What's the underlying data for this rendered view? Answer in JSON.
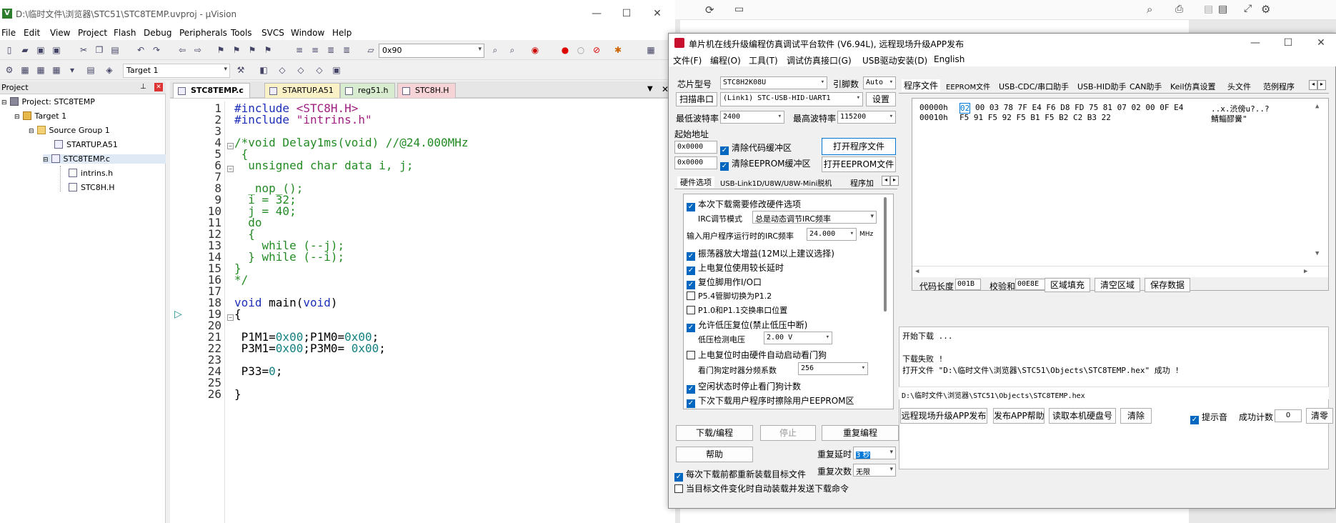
{
  "uvision": {
    "title": "D:\\临时文件\\浏览器\\STC51\\STC8TEMP.uvproj - µVision",
    "menu": [
      "File",
      "Edit",
      "View",
      "Project",
      "Flash",
      "Debug",
      "Peripherals",
      "Tools",
      "SVCS",
      "Window",
      "Help"
    ],
    "toolbar_value": "0x90",
    "target_select": "Target 1",
    "project_header": "Project",
    "tree": {
      "project": "Project: STC8TEMP",
      "target": "Target 1",
      "group": "Source Group 1",
      "files": [
        "STARTUP.A51",
        "STC8TEMP.c",
        "intrins.h",
        "STC8H.H"
      ]
    },
    "tabs": [
      "STC8TEMP.c",
      "STARTUP.A51",
      "reg51.h",
      "STC8H.H"
    ],
    "line_numbers": [
      "1",
      "2",
      "3",
      "4",
      "5",
      "6",
      "7",
      "8",
      "9",
      "10",
      "11",
      "12",
      "13",
      "14",
      "15",
      "16",
      "17",
      "18",
      "19",
      "20",
      "21",
      "22",
      "23",
      "24",
      "25",
      "26"
    ]
  },
  "isp": {
    "title": "单片机在线升级编程仿真调试平台软件 (V6.94L), 远程现场升级APP发布",
    "menu": [
      "文件(F)",
      "编程(O)",
      "工具(T)",
      "调试仿真接口(G)",
      "USB驱动安装(D)",
      "English"
    ],
    "chip_label": "芯片型号",
    "chip_value": "STC8H2K08U",
    "pin_label": "引脚数",
    "pin_value": "Auto",
    "port_btn": "扫描串口",
    "port_value": "(Link1) STC-USB-HID-UART1",
    "settings_btn": "设置",
    "min_baud_label": "最低波特率",
    "min_baud_value": "2400",
    "max_baud_label": "最高波特率",
    "max_baud_value": "115200",
    "start_addr_label": "起始地址",
    "addr1": "0x0000",
    "addr2": "0x0000",
    "clear_code": "清除代码缓冲区",
    "clear_eeprom": "清除EEPROM缓冲区",
    "open_prog_btn": "打开程序文件",
    "open_eeprom_btn": "打开EEPROM文件",
    "opt_tabs": [
      "硬件选项",
      "USB-Link1D/U8W/U8W-Mini脱机",
      "程序加"
    ],
    "opts": {
      "o1": "本次下载需要修改硬件选项",
      "irc_mode_label": "IRC调节模式",
      "irc_mode_value": "总是动态调节IRC频率",
      "irc_freq_label": "输入用户程序运行时的IRC频率",
      "irc_freq_value": "24.000",
      "irc_freq_unit": "MHz",
      "o2": "振荡器放大增益(12M以上建议选择)",
      "o3": "上电复位使用较长延时",
      "o4": "复位脚用作I/O口",
      "o5": "P5.4管脚切换为P1.2",
      "o6": "P1.0和P1.1交换串口位置",
      "o7": "允许低压复位(禁止低压中断)",
      "lv_label": "低压检测电压",
      "lv_value": "2.00 V",
      "o8": "上电复位时由硬件自动启动看门狗",
      "wdt_label": "看门狗定时器分频系数",
      "wdt_value": "256",
      "o9": "空闲状态时停止看门狗计数",
      "o10": "下次下载用户程序时擦除用户EEPROM区"
    },
    "download_btn": "下载/编程",
    "stop_btn": "停止",
    "reprog_btn": "重复编程",
    "help_btn": "帮助",
    "delay_label": "重复延时",
    "delay_value": "3 秒",
    "count_label": "重复次数",
    "count_value": "无限",
    "reload_chk": "每次下载前都重新装载目标文件",
    "auto_chk": "当目标文件变化时自动装载并发送下载命令",
    "right_tabs": [
      "程序文件",
      "EEPROM文件",
      "USB-CDC/串口助手",
      "USB-HID助手",
      "CAN助手",
      "Keil仿真设置",
      "头文件",
      "范例程序"
    ],
    "hex_rows": [
      {
        "addr": "00000h",
        "first": "02",
        "bytes": "00 03 78 7F E4 F6 D8 FD 75 81 07 02 00 0F E4",
        "ascii": "..x.渋傍u?..?"
      },
      {
        "addr": "00010h",
        "first": "",
        "bytes": "F5 91 F5 92 F5 B1 F5 B2 C2 B3 22",
        "ascii": "鯖鯔醪黌\""
      }
    ],
    "code_len_label": "代码长度",
    "code_len_value": "001B",
    "checksum_label": "校验和",
    "checksum_value": "00E8E",
    "fill_btn": "区域填充",
    "clear_area_btn": "清空区域",
    "save_btn": "保存数据",
    "log": [
      "开始下载 ...",
      "",
      "下载失败 !",
      "打开文件 \"D:\\临时文件\\浏览器\\STC51\\Objects\\STC8TEMP.hex\" 成功 !"
    ],
    "path": "D:\\临时文件\\浏览器\\STC51\\Objects\\STC8TEMP.hex",
    "remote_btn": "远程现场升级APP发布",
    "publish_help_btn": "发布APP帮助",
    "read_disk_btn": "读取本机硬盘号",
    "clear_btn": "清除",
    "beep_chk": "提示音",
    "success_label": "成功计数",
    "success_value": "0",
    "clear_count_btn": "清零"
  }
}
